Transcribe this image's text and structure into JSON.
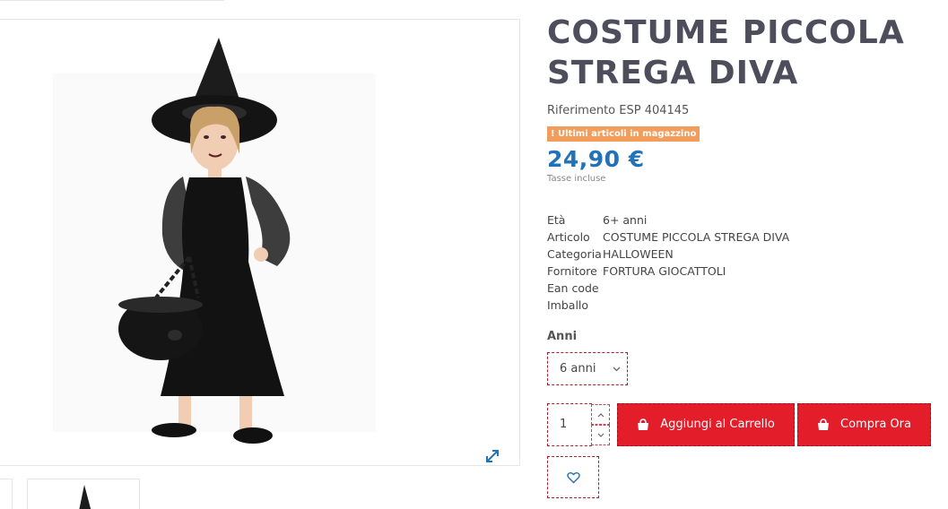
{
  "product": {
    "title": "COSTUME PICCOLA STREGA DIVA",
    "reference": "Riferimento ESP 404145",
    "stock_badge": "Ultimi articoli in magazzino",
    "price": "24,90 €",
    "tax_note": "Tasse incluse"
  },
  "features": [
    {
      "key": "Età",
      "value": "6+ anni"
    },
    {
      "key": "Articolo",
      "value": "COSTUME PICCOLA STREGA DIVA"
    },
    {
      "key": "Categoria",
      "value": "HALLOWEEN"
    },
    {
      "key": "Fornitore",
      "value": "FORTURA GIOCATTOLI"
    },
    {
      "key": "Ean code",
      "value": ""
    },
    {
      "key": "Imballo",
      "value": ""
    }
  ],
  "variant": {
    "label": "Anni",
    "selected": "6 anni"
  },
  "quantity": {
    "value": "1"
  },
  "actions": {
    "add_to_cart": "Aggiungi al Carrello",
    "buy_now": "Compra Ora"
  },
  "icons": {
    "expand": "expand-icon",
    "cart": "shopping-bag-icon",
    "wishlist": "heart-icon",
    "stock_warning": "exclamation-icon"
  },
  "colors": {
    "accent_red": "#e31e2a",
    "price_blue": "#2172b8",
    "badge_orange": "#f39d5c",
    "title_gray": "#4d4d5c"
  }
}
